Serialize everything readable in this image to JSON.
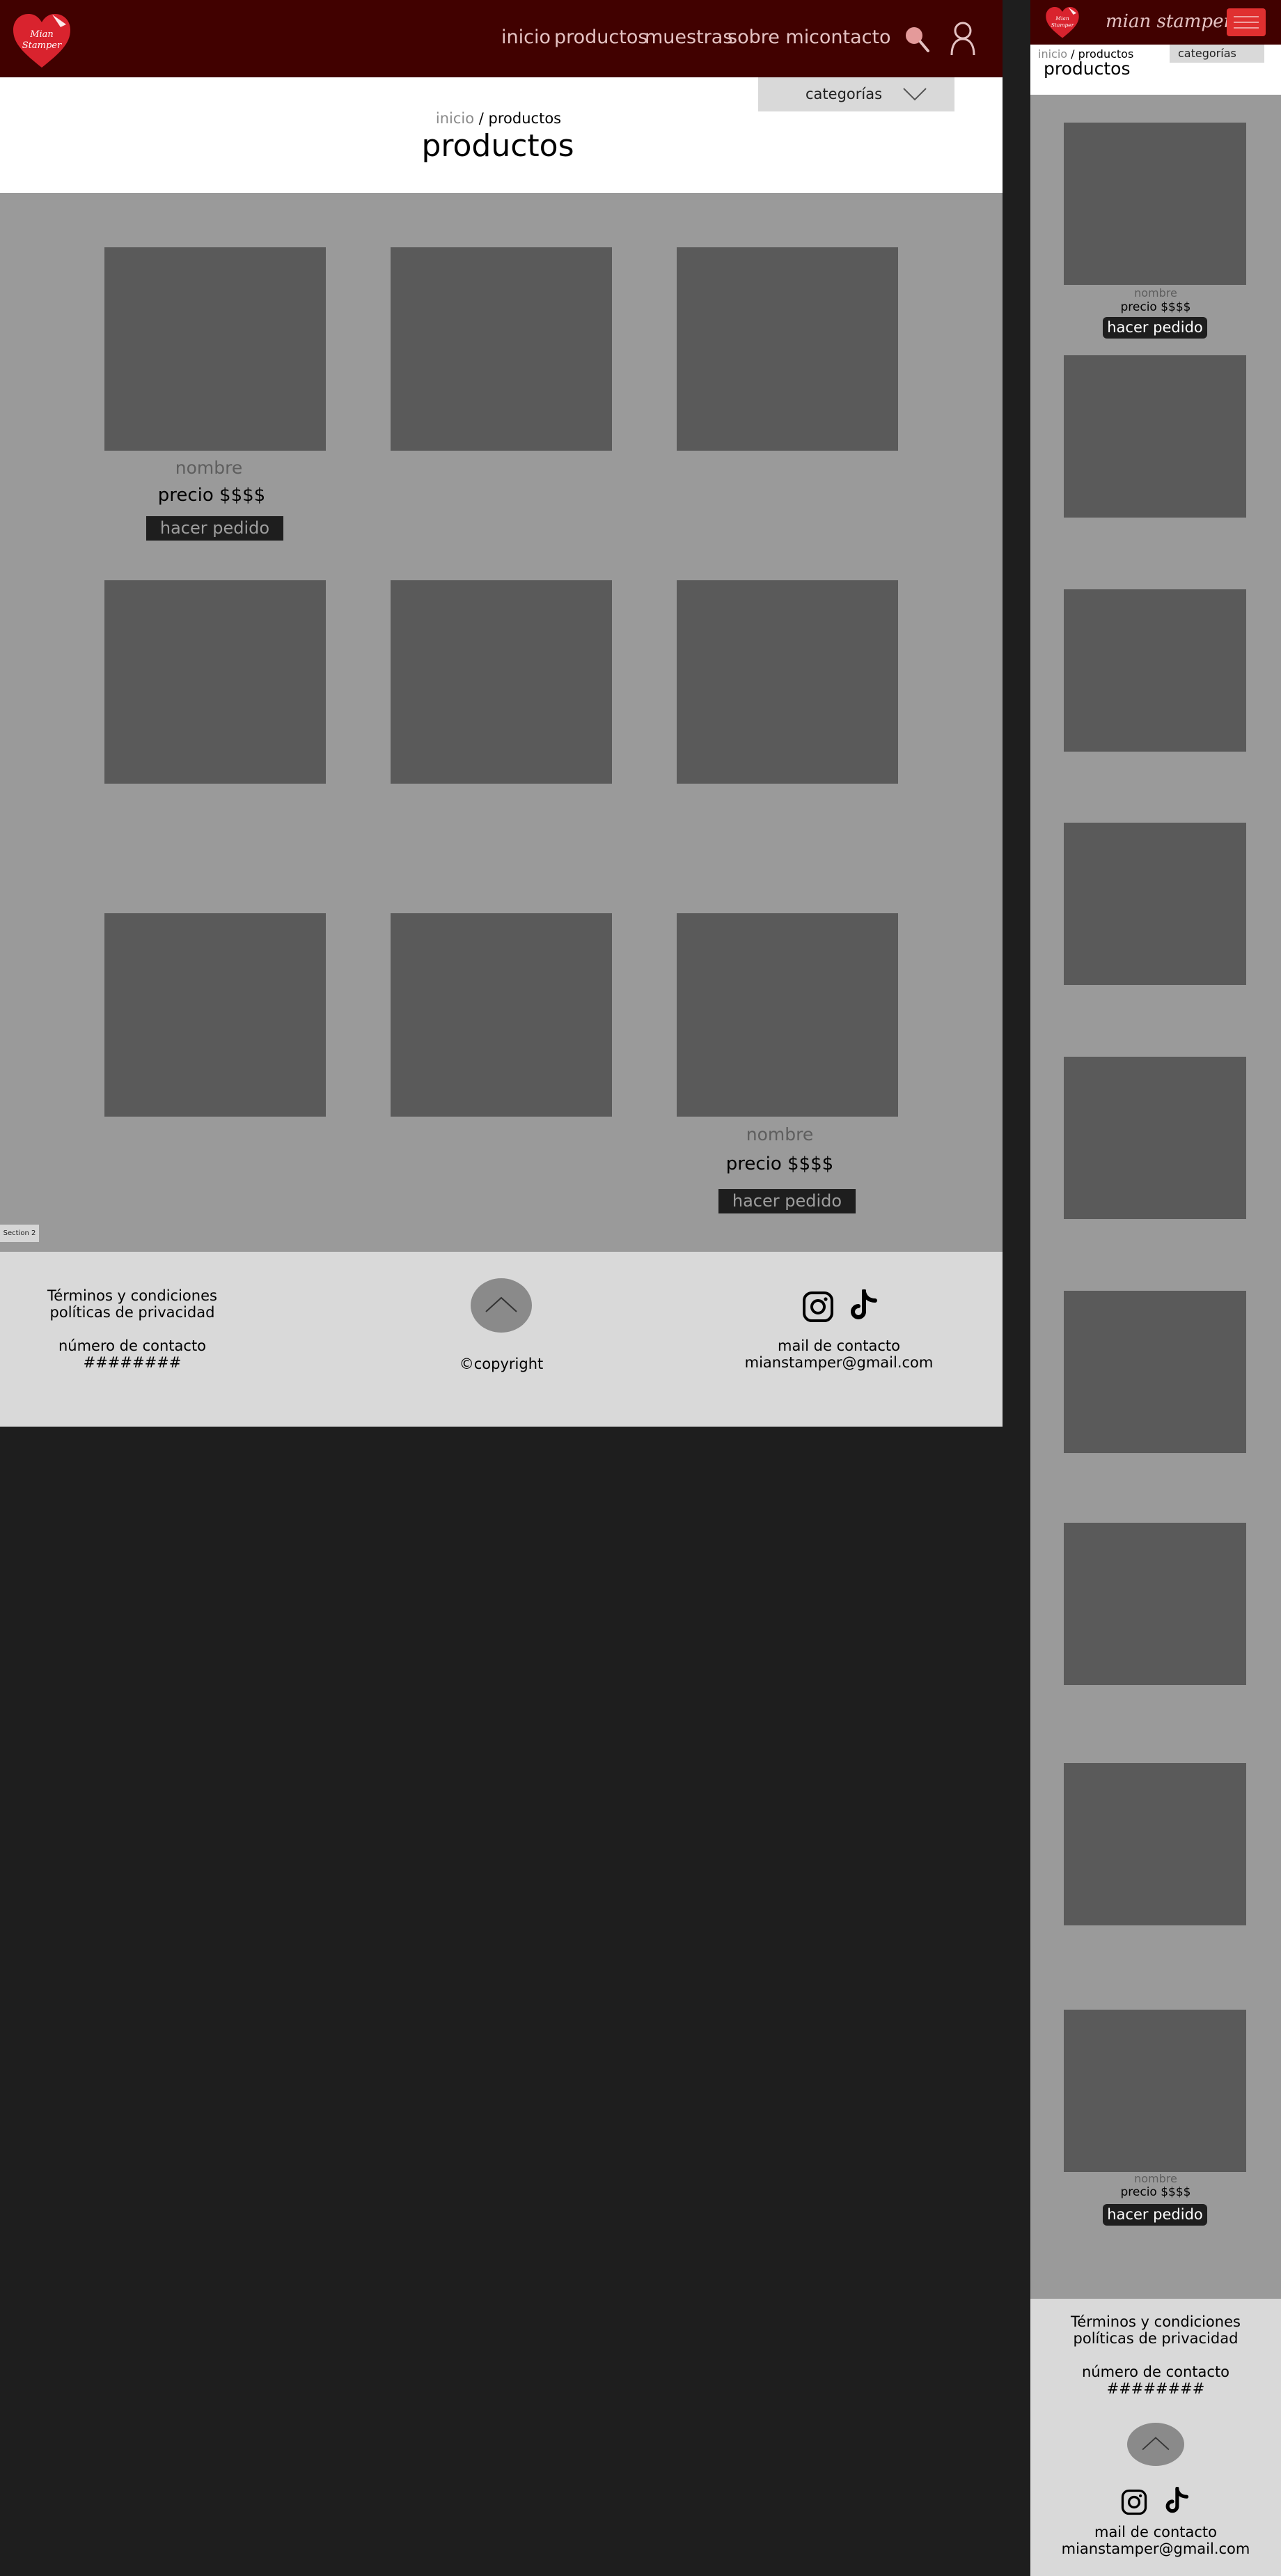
{
  "brand": {
    "logo_text": "Mian Stamper",
    "mobile_name": "mian stamper",
    "colors": {
      "header": "#410100",
      "accent_red": "#e03030",
      "nav_text": "#e4c2c2",
      "placeholder": "#5a5a5a",
      "grid_bg": "#9a9a9a",
      "footer_bg": "#d9d9d9"
    }
  },
  "nav": {
    "items": [
      "inicio",
      "productos",
      "muestras",
      "sobre mi",
      "contacto"
    ],
    "search_icon": "search-icon",
    "user_icon": "user-icon"
  },
  "page": {
    "breadcrumb_home": "inicio",
    "breadcrumb_sep": " / ",
    "breadcrumb_current": "productos",
    "title": "productos",
    "categories_label": "categorías",
    "categories_icon": "chevron-down-icon"
  },
  "product": {
    "name": "nombre",
    "price": "precio $$$$",
    "order_button": "hacer pedido"
  },
  "section_tag": "Section 2",
  "footer": {
    "terms": "Términos y condiciones",
    "privacy": "políticas de privacidad",
    "contact_number_label": "número de contacto",
    "contact_number": "########",
    "copyright": "©copyright",
    "mail_label": "mail de contacto",
    "mail": "mianstamper@gmail.com",
    "social_icons": [
      "instagram-icon",
      "tiktok-icon"
    ],
    "back_to_top_icon": "chevron-up-icon"
  }
}
